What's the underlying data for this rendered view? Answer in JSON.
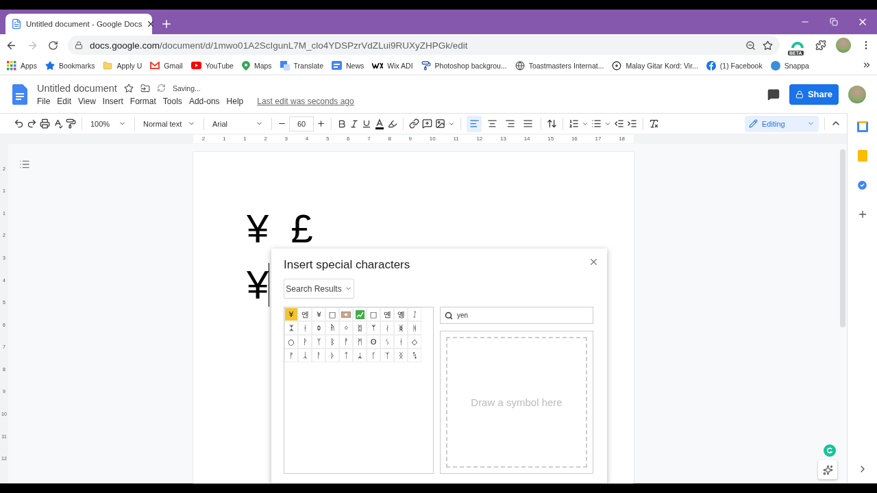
{
  "browser": {
    "tab": {
      "title": "Untitled document - Google Docs"
    },
    "url_host": "docs.google.com",
    "url_path": "/document/d/1mwo01A2ScIgunL7M_clo4YDSPzrVdZLui9RUXyZHPGk/edit",
    "extension_badge": "BETA",
    "bookmarks": [
      {
        "kind": "apps",
        "label": "Apps"
      },
      {
        "kind": "star",
        "label": "Bookmarks"
      },
      {
        "kind": "folder",
        "label": "Apply U"
      },
      {
        "kind": "mail",
        "label": "Gmail"
      },
      {
        "kind": "video",
        "label": "YouTube"
      },
      {
        "kind": "map",
        "label": "Maps"
      },
      {
        "kind": "translate",
        "label": "Translate"
      },
      {
        "kind": "news",
        "label": "News"
      },
      {
        "kind": "wix",
        "label": "Wix ADI"
      },
      {
        "kind": "brush",
        "label": "Photoshop backgrou..."
      },
      {
        "kind": "globe",
        "label": "Toastmasters Internat..."
      },
      {
        "kind": "disc",
        "label": "Malay Gitar Kord: Vir..."
      },
      {
        "kind": "social",
        "label": "(1) Facebook"
      },
      {
        "kind": "snappa",
        "label": "Snappa"
      }
    ]
  },
  "docs": {
    "title": "Untitled document",
    "status": "Saving...",
    "menus": [
      "File",
      "Edit",
      "View",
      "Insert",
      "Format",
      "Tools",
      "Add-ons",
      "Help"
    ],
    "last_edit": "Last edit was seconds ago",
    "share": "Share",
    "zoom": "100%",
    "style": "Normal text",
    "font": "Arial",
    "font_size": "60",
    "alignments": [
      {
        "kind": "left",
        "selected": true
      },
      {
        "kind": "center",
        "selected": false
      },
      {
        "kind": "right",
        "selected": false
      },
      {
        "kind": "justify",
        "selected": false
      }
    ],
    "mode": "Editing",
    "ruler": [
      "2",
      "1",
      "1",
      "2",
      "3",
      "4",
      "5",
      "6",
      "7",
      "8",
      "9",
      "10",
      "11",
      "12",
      "13",
      "14",
      "15",
      "16",
      "17",
      "18"
    ],
    "vertical_ruler": [
      "2",
      "1",
      "1",
      "2",
      "3",
      "4",
      "5",
      "6",
      "7",
      "8",
      "9",
      "10",
      "11",
      "12"
    ],
    "lines": [
      "¥  £",
      "¥"
    ]
  },
  "dialog": {
    "title": "Insert special characters",
    "category": "Search Results",
    "search": "yen",
    "draw_placeholder": "Draw a symbol here",
    "rows": [
      [
        {
          "kind": "glyph",
          "char": "¥",
          "selected": true
        },
        {
          "kind": "glyph",
          "char": "엔",
          "selected": false
        },
        {
          "kind": "glyph",
          "char": "￥",
          "selected": false
        },
        {
          "kind": "glyph",
          "char": "□",
          "selected": false
        },
        {
          "kind": "banknote",
          "selected": false
        },
        {
          "kind": "chart",
          "selected": false
        },
        {
          "kind": "glyph",
          "char": "□",
          "selected": false
        },
        {
          "kind": "glyph",
          "char": "옌",
          "selected": false
        },
        {
          "kind": "glyph",
          "char": "옝",
          "selected": false
        },
        {
          "kind": "glyph",
          "char": "ᛇ",
          "selected": false
        }
      ],
      [
        {
          "kind": "glyph",
          "char": "ᛯ",
          "selected": false
        },
        {
          "kind": "glyph",
          "char": "ᚽ",
          "selected": false
        },
        {
          "kind": "glyph",
          "char": "ᛰ",
          "selected": false
        },
        {
          "kind": "glyph",
          "char": "ᚥ",
          "selected": false
        },
        {
          "kind": "glyph",
          "char": "ᛜ",
          "selected": false
        },
        {
          "kind": "glyph",
          "char": "ᛥ",
          "selected": false
        },
        {
          "kind": "glyph",
          "char": "ᛘ",
          "selected": false
        },
        {
          "kind": "glyph",
          "char": "ᛅ",
          "selected": false
        },
        {
          "kind": "glyph",
          "char": "ᛤ",
          "selected": false
        },
        {
          "kind": "glyph",
          "char": "ᚻ",
          "selected": false
        }
      ],
      [
        {
          "kind": "glyph",
          "char": "○",
          "selected": false
        },
        {
          "kind": "glyph",
          "char": "ᚹ",
          "selected": false
        },
        {
          "kind": "glyph",
          "char": "ᛉ",
          "selected": false
        },
        {
          "kind": "glyph",
          "char": "ᛒ",
          "selected": false
        },
        {
          "kind": "glyph",
          "char": "ᚡ",
          "selected": false
        },
        {
          "kind": "glyph",
          "char": "ᛗ",
          "selected": false
        },
        {
          "kind": "glyph",
          "char": "ʘ",
          "selected": false
        },
        {
          "kind": "glyph",
          "char": "ᛊ",
          "selected": false
        },
        {
          "kind": "glyph",
          "char": "ᛂ",
          "selected": false
        },
        {
          "kind": "glyph",
          "char": "◇",
          "selected": false
        }
      ],
      [
        {
          "kind": "glyph",
          "char": "ᚠ",
          "selected": false
        },
        {
          "kind": "glyph",
          "char": "ᛣ",
          "selected": false
        },
        {
          "kind": "glyph",
          "char": "ᚨ",
          "selected": false
        },
        {
          "kind": "glyph",
          "char": "ᚦ",
          "selected": false
        },
        {
          "kind": "glyph",
          "char": "ᛏ",
          "selected": false
        },
        {
          "kind": "glyph",
          "char": "ᛦ",
          "selected": false
        },
        {
          "kind": "glyph",
          "char": "ᚴ",
          "selected": false
        },
        {
          "kind": "glyph",
          "char": "ᛉ",
          "selected": false
        },
        {
          "kind": "glyph",
          "char": "ᛝ",
          "selected": false
        },
        {
          "kind": "glyph",
          "char": "ᛪ",
          "selected": false
        }
      ]
    ]
  }
}
